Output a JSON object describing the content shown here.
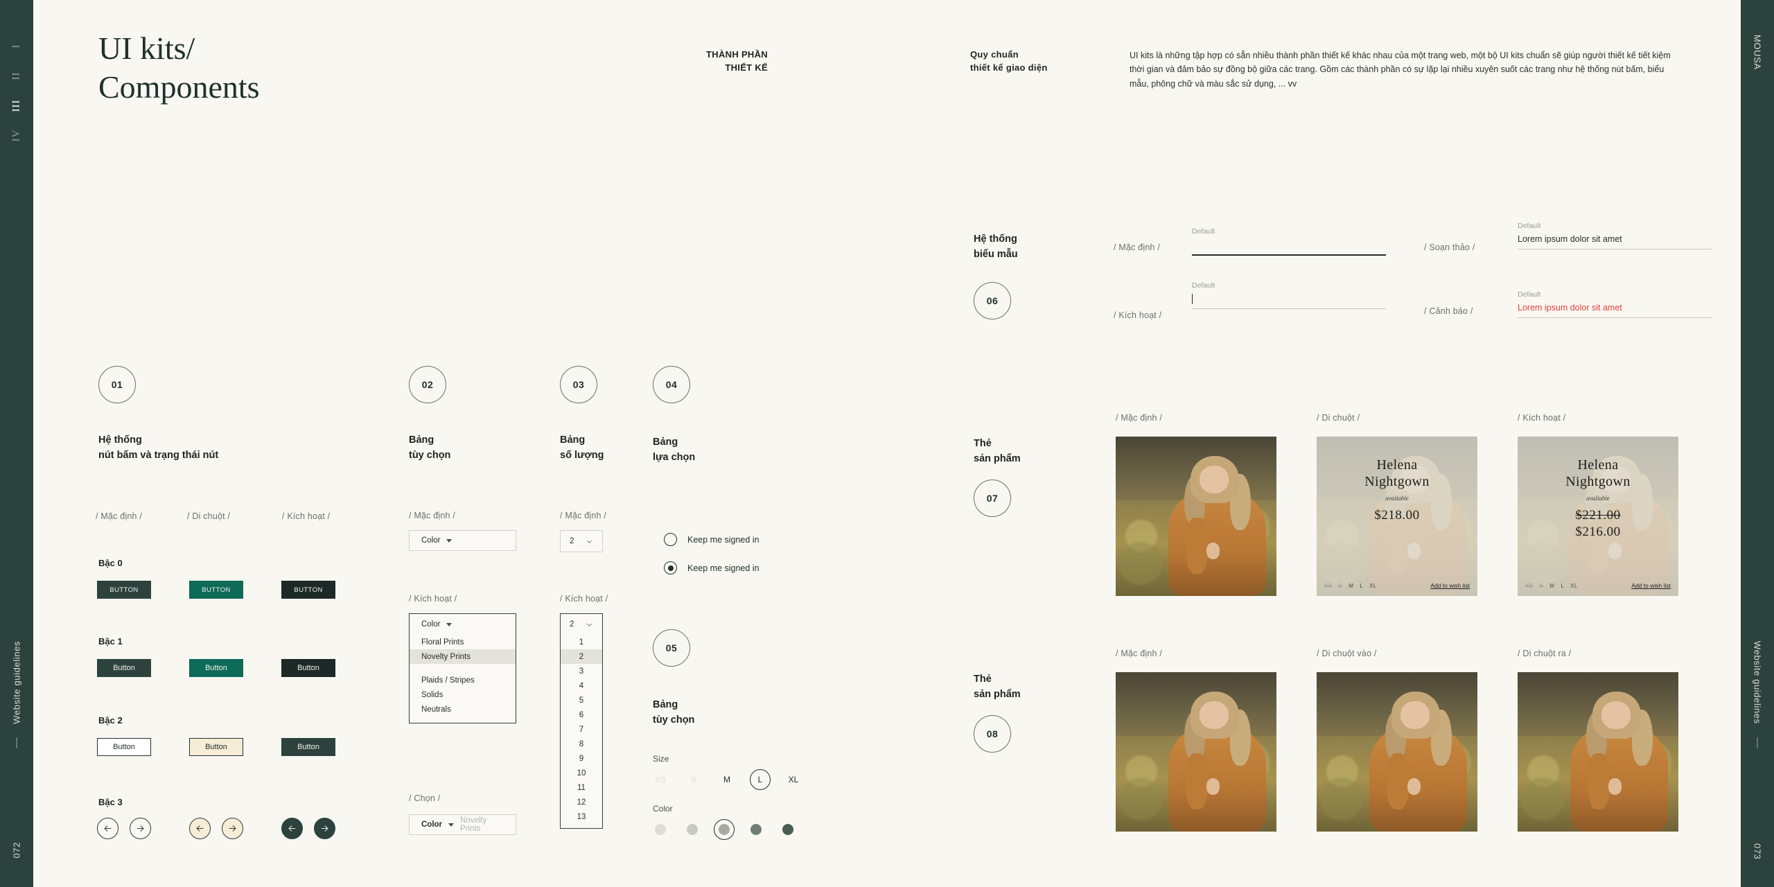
{
  "rails": {
    "left": {
      "numerals": [
        "I",
        "II",
        "III",
        "IV"
      ],
      "active_numeral": "III",
      "label": "Website guidelines",
      "page": "072"
    },
    "right": {
      "brand": "MOUSA",
      "label": "Website guidelines",
      "page": "073"
    }
  },
  "header": {
    "title_line1": "UI kits/",
    "title_line2": "Components",
    "label_left_line1": "THÀNH PHẦN",
    "label_left_line2": "THIẾT KẾ",
    "label_right_line1": "Quy chuẩn",
    "label_right_line2": "thiết kế giao diện",
    "paragraph": "UI kits là những tập hợp có sẵn nhiều thành phần thiết kế khác nhau của một trang web, một bộ UI kits chuẩn sẽ giúp người thiết kế tiết kiệm thời gian và đảm bảo sự đồng bộ giữa các trang. Gồm các thành phần có sự lặp lại nhiều xuyên suốt các trang như hệ thống nút bấm, biểu mẫu, phông chữ và màu sắc sử dụng, ... vv"
  },
  "states": {
    "default": "/ Mặc định /",
    "hover": "/ Di chuột /",
    "active": "/ Kích hoạt /",
    "choose": "/ Chọn /",
    "draft": "/ Soạn thảo /",
    "warning": "/ Cảnh báo /",
    "hover_in": "/ Di chuột vào /",
    "hover_out": "/ Di chuột ra /"
  },
  "sections": {
    "s01": {
      "number": "01",
      "title_line1": "Hệ thống",
      "title_line2": "nút bấm và trạng thái nút"
    },
    "s02": {
      "number": "02",
      "title_line1": "Bảng",
      "title_line2": "tùy chọn"
    },
    "s03": {
      "number": "03",
      "title_line1": "Bảng",
      "title_line2": "số lượng"
    },
    "s04": {
      "number": "04",
      "title_line1": "Bảng",
      "title_line2": "lựa chọn"
    },
    "s05": {
      "number": "05",
      "title_line1": "Bảng",
      "title_line2": "tùy chọn"
    },
    "s06": {
      "number": "06",
      "title_line1": "Hệ thống",
      "title_line2": "biểu mẫu"
    },
    "s07": {
      "number": "07",
      "title_line1": "Thẻ",
      "title_line2": "sản phẩm"
    },
    "s08": {
      "number": "08",
      "title_line1": "Thẻ",
      "title_line2": "sản phẩm"
    }
  },
  "buttons": {
    "tiers": [
      {
        "label": "Bậc 0",
        "text": "BUTTON"
      },
      {
        "label": "Bậc 1",
        "text": "Button"
      },
      {
        "label": "Bậc 2",
        "text": "Button"
      },
      {
        "label": "Bậc 3",
        "text": ""
      }
    ],
    "colors": {
      "solid_default": "#2d423d",
      "solid_hover": "#0e6b58",
      "solid_active": "#1d2926",
      "ghost_hover_bg": "#f7ecd6"
    }
  },
  "select_option": {
    "placeholder": "Color",
    "selected": "Novelty Prints",
    "items": [
      "Floral Prints",
      "Novelty Prints",
      "Plaids / Stripes",
      "Solids",
      "Neutrals"
    ],
    "highlighted": "Novelty Prints"
  },
  "select_qty": {
    "value": "2",
    "items": [
      "1",
      "2",
      "3",
      "4",
      "5",
      "6",
      "7",
      "8",
      "9",
      "10",
      "11",
      "12",
      "13"
    ],
    "highlighted": "2"
  },
  "radios": {
    "option1": "Keep me signed in",
    "option2": "Keep me signed in",
    "selected_index": 1
  },
  "product_options": {
    "size_label": "Size",
    "sizes": [
      "XS",
      "S",
      "M",
      "L",
      "XL"
    ],
    "disabled_sizes": [
      "XS",
      "S"
    ],
    "selected_size": "L",
    "color_label": "Color",
    "swatches": [
      "#dedcd5",
      "#c8cbc2",
      "#a8aaa3",
      "#6f7f76",
      "#4b5c54"
    ],
    "selected_swatch_index": 2
  },
  "form_fields": [
    {
      "state": "/ Mặc định /",
      "caption": "Default",
      "value": "",
      "style": "strong"
    },
    {
      "state": "/ Soạn thảo /",
      "caption": "Default",
      "value": "Lorem ipsum dolor sit amet",
      "style": "normal"
    },
    {
      "state": "/ Kích hoạt /",
      "caption": "Default",
      "value": "",
      "style": "caret"
    },
    {
      "state": "/ Cảnh báo /",
      "caption": "Default",
      "value": "Lorem ipsum dolor sit amet",
      "style": "warn"
    }
  ],
  "product_cards": {
    "row1_labels": [
      "/ Mặc định /",
      "/ Di chuột /",
      "/ Kích hoạt /"
    ],
    "row2_labels": [
      "/ Mặc định /",
      "/ Di chuột vào /",
      "/ Di chuột ra /"
    ],
    "name_line1": "Helena",
    "name_line2": "Nightgown",
    "availability": "available",
    "price": "$218.00",
    "price_old": "$221.00",
    "price_new": "$216.00",
    "sizes": [
      "XS",
      "S",
      "M",
      "L",
      "XL"
    ],
    "wishlist": "Add to wish list"
  },
  "colors": {
    "rail": "#2c423d",
    "page_bg": "#f8f7f2",
    "accent": "#0e6b58",
    "warning": "#e8413f"
  }
}
